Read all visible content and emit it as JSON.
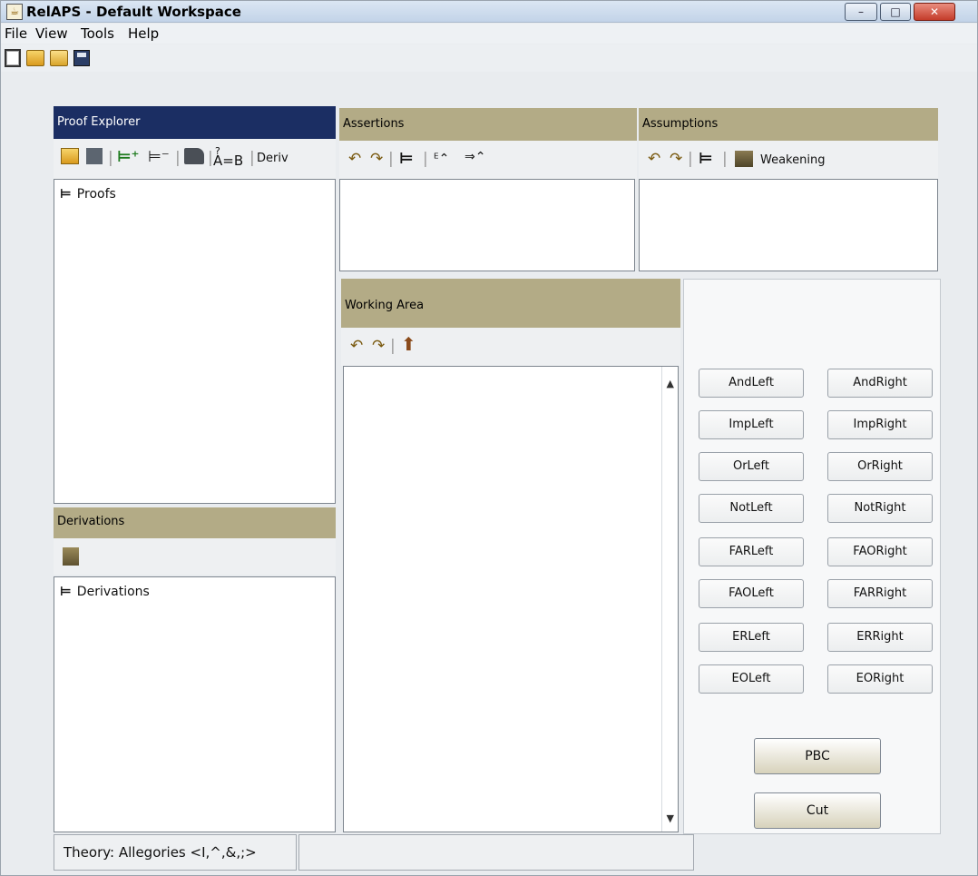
{
  "window": {
    "title": "RelAPS - Default Workspace",
    "min_label": "–",
    "max_label": "□",
    "close_label": "✕"
  },
  "menu": [
    "File",
    "View",
    "Tools",
    "Help"
  ],
  "toolbar": {
    "icons": [
      "new-icon",
      "open-icon",
      "open-folder-icon",
      "save-icon"
    ]
  },
  "proof_explorer": {
    "title": "Proof Explorer",
    "tools": {
      "eq_label": "A=B",
      "eq_over": "?",
      "derive_label": "Deriv",
      "add_sym": "⊨⁺",
      "remove_sym": "⊨⁻"
    },
    "tree_root": "Proofs"
  },
  "derivations": {
    "title": "Derivations",
    "tree_root": "Derivations"
  },
  "assertions": {
    "title": "Assertions"
  },
  "assumptions": {
    "title": "Assumptions",
    "weakening_label": "Weakening"
  },
  "working_area": {
    "title": "Working Area"
  },
  "rules": {
    "left": [
      "AndLeft",
      "ImpLeft",
      "OrLeft",
      "NotLeft",
      "FARLeft",
      "FAOLeft",
      "ERLeft",
      "EOLeft"
    ],
    "right": [
      "AndRight",
      "ImpRight",
      "OrRight",
      "NotRight",
      "FAORight",
      "FARRight",
      "ERRight",
      "EORight"
    ],
    "pbc": "PBC",
    "cut": "Cut"
  },
  "status": {
    "theory": "Theory: Allegories <I,^,&,;>"
  }
}
